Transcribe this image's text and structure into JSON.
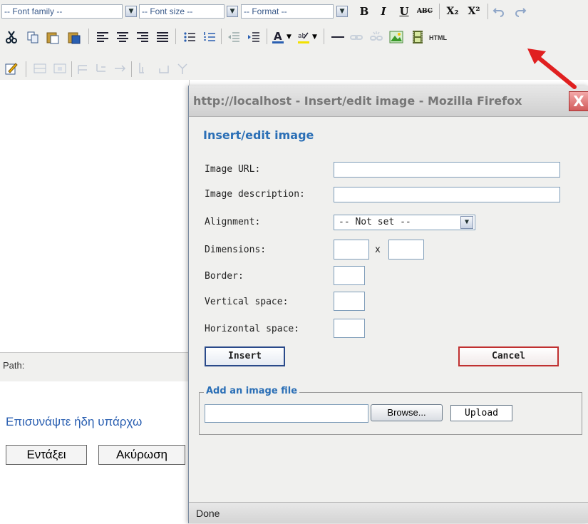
{
  "toolbar": {
    "font_family": "-- Font family --",
    "font_size": "-- Font size --",
    "format": "-- Format --",
    "bold": "B",
    "italic": "I",
    "underline": "U",
    "strike": "ABC",
    "subscript": "X₂",
    "superscript": "X²",
    "html_label": "HTML"
  },
  "editor": {
    "path_label": "Path:"
  },
  "page": {
    "greek_text": "Επισυνάψτε ήδη υπάρχω",
    "ok_button": "Εντάξει",
    "cancel_button": "Ακύρωση"
  },
  "popup": {
    "window_title": "http://localhost - Insert/edit image - Mozilla Firefox",
    "close_glyph": "X",
    "dialog_title": "Insert/edit image",
    "fields": {
      "image_url": "Image URL:",
      "image_description": "Image description:",
      "alignment": "Alignment:",
      "alignment_value": "-- Not set --",
      "dimensions": "Dimensions:",
      "dimensions_x": "x",
      "border": "Border:",
      "vertical_space": "Vertical space:",
      "horizontal_space": "Horizontal space:"
    },
    "insert_button": "Insert",
    "cancel_button": "Cancel",
    "add_file_legend": "Add an image file",
    "browse_button": "Browse...",
    "upload_button": "Upload",
    "status": "Done"
  },
  "colors": {
    "link_blue": "#2b6fb6",
    "pointer_arrow": "#e02020"
  }
}
